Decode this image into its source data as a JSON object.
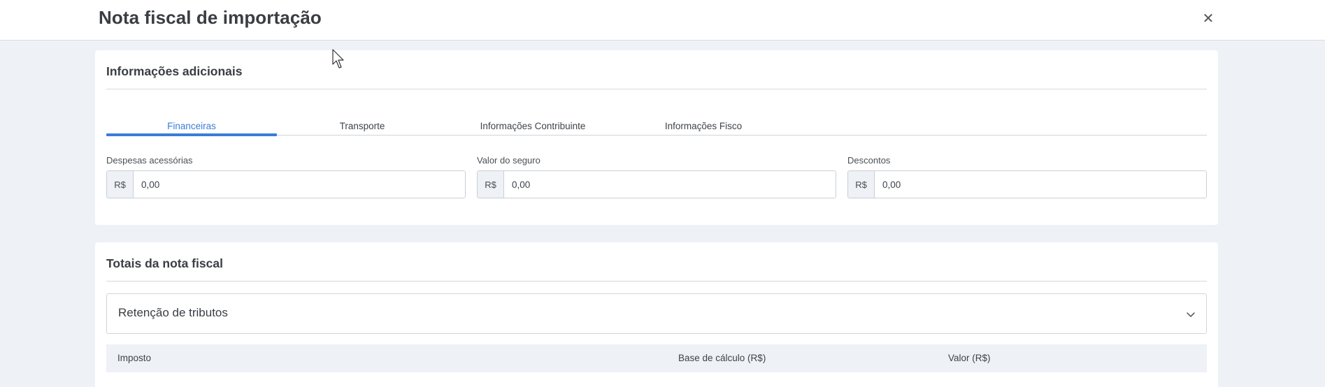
{
  "modal": {
    "title": "Nota fiscal de importação",
    "close_symbol": "✕"
  },
  "additional_info": {
    "title": "Informações adicionais",
    "tabs": [
      {
        "label": "Financeiras",
        "active": true
      },
      {
        "label": "Transporte",
        "active": false
      },
      {
        "label": "Informações Contribuinte",
        "active": false
      },
      {
        "label": "Informações Fisco",
        "active": false
      }
    ],
    "fields": [
      {
        "label": "Despesas acessórias",
        "prefix": "R$",
        "value": "0,00"
      },
      {
        "label": "Valor do seguro",
        "prefix": "R$",
        "value": "0,00"
      },
      {
        "label": "Descontos",
        "prefix": "R$",
        "value": "0,00"
      }
    ]
  },
  "totals": {
    "title": "Totais da nota fiscal",
    "accordion": {
      "title": "Retenção de tributos",
      "icon": "chevron-down-icon"
    },
    "table": {
      "headers": [
        "Imposto",
        "Base de cálculo (R$)",
        "Valor (R$)"
      ]
    }
  },
  "colors": {
    "accent": "#3b7dd8",
    "background": "#eef1f5",
    "card": "#ffffff"
  }
}
